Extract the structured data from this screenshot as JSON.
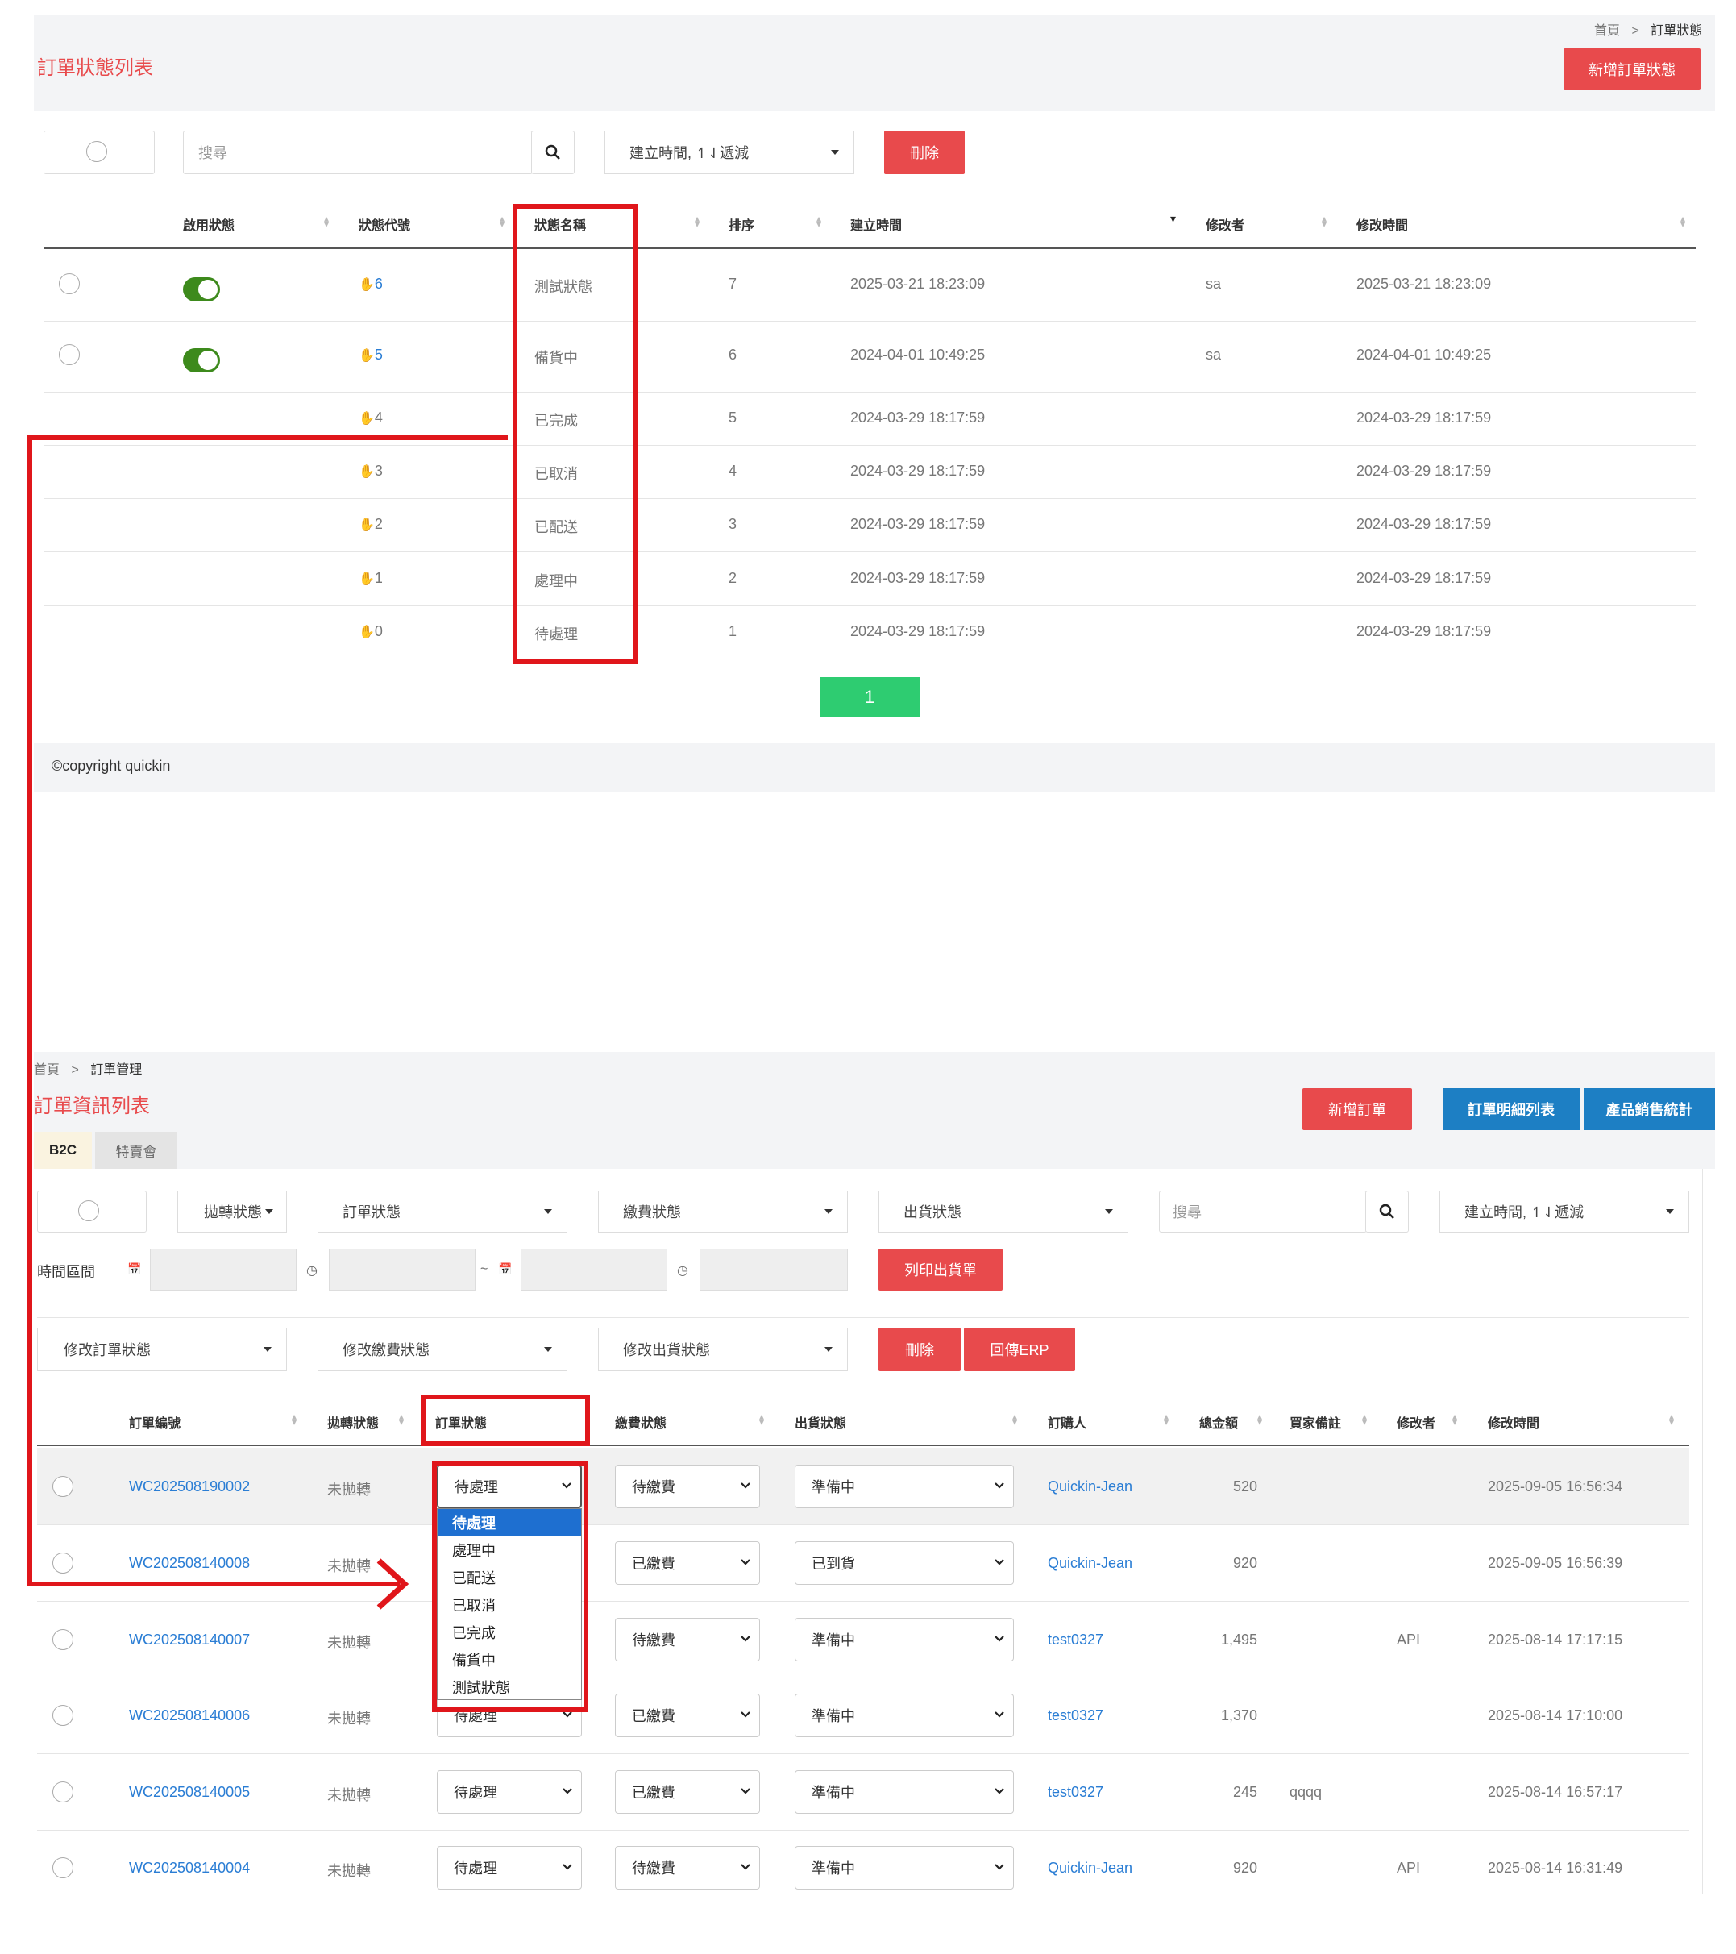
{
  "top": {
    "breadcrumb": {
      "home": "首頁",
      "sep": ">",
      "current": "訂單狀態"
    },
    "title": "訂單狀態列表",
    "add_button": "新增訂單狀態",
    "search_placeholder": "搜尋",
    "sort_dropdown": "建立時間, ↿⇃遞減",
    "delete_button": "刪除",
    "columns": [
      "啟用狀態",
      "狀態代號",
      "狀態名稱",
      "排序",
      "建立時間",
      "修改者",
      "修改時間"
    ],
    "rows": [
      {
        "enabled": true,
        "code": "6",
        "name": "測試狀態",
        "order": "7",
        "created": "2025-03-21 18:23:09",
        "modifier": "sa",
        "modified": "2025-03-21 18:23:09"
      },
      {
        "enabled": true,
        "code": "5",
        "name": "備貨中",
        "order": "6",
        "created": "2024-04-01 10:49:25",
        "modifier": "sa",
        "modified": "2024-04-01 10:49:25"
      },
      {
        "enabled": false,
        "code": "4",
        "name": "已完成",
        "order": "5",
        "created": "2024-03-29 18:17:59",
        "modifier": "",
        "modified": "2024-03-29 18:17:59"
      },
      {
        "enabled": false,
        "code": "3",
        "name": "已取消",
        "order": "4",
        "created": "2024-03-29 18:17:59",
        "modifier": "",
        "modified": "2024-03-29 18:17:59"
      },
      {
        "enabled": false,
        "code": "2",
        "name": "已配送",
        "order": "3",
        "created": "2024-03-29 18:17:59",
        "modifier": "",
        "modified": "2024-03-29 18:17:59"
      },
      {
        "enabled": false,
        "code": "1",
        "name": "處理中",
        "order": "2",
        "created": "2024-03-29 18:17:59",
        "modifier": "",
        "modified": "2024-03-29 18:17:59"
      },
      {
        "enabled": false,
        "code": "0",
        "name": "待處理",
        "order": "1",
        "created": "2024-03-29 18:17:59",
        "modifier": "",
        "modified": "2024-03-29 18:17:59"
      }
    ],
    "page": "1",
    "copyright": "©copyright quickin"
  },
  "bottom": {
    "breadcrumb": {
      "home": "首頁",
      "sep": ">",
      "current": "訂單管理"
    },
    "title": "訂單資訊列表",
    "add_order": "新增訂單",
    "detail_list": "訂單明細列表",
    "sales_stats": "產品銷售統計",
    "tabs": [
      "B2C",
      "特賣會"
    ],
    "filters": {
      "transfer": "拋轉狀態",
      "order_status": "訂單狀態",
      "payment_status": "繳費狀態",
      "shipping_status": "出貨狀態",
      "search_placeholder": "搜尋",
      "sort": "建立時間, ↿⇃遞減",
      "time_range": "時間區間",
      "tilde": "~",
      "print_button": "列印出貨單"
    },
    "bulk": {
      "order_status": "修改訂單狀態",
      "payment_status": "修改繳費狀態",
      "shipping_status": "修改出貨狀態",
      "delete": "刪除",
      "erp": "回傳ERP"
    },
    "columns": [
      "訂單編號",
      "拋轉狀態",
      "訂單狀態",
      "繳費狀態",
      "出貨狀態",
      "訂購人",
      "總金額",
      "買家備註",
      "修改者",
      "修改時間"
    ],
    "rows": [
      {
        "id": "WC202508190002",
        "transfer": "未拋轉",
        "order_status": "待處理",
        "payment": "待繳費",
        "shipping": "準備中",
        "buyer": "Quickin-Jean",
        "total": "520",
        "note": "",
        "modifier": "",
        "modified": "2025-09-05 16:56:34"
      },
      {
        "id": "WC202508140008",
        "transfer": "未拋轉",
        "order_status": "待處理",
        "payment": "已繳費",
        "shipping": "已到貨",
        "buyer": "Quickin-Jean",
        "total": "920",
        "note": "",
        "modifier": "",
        "modified": "2025-09-05 16:56:39"
      },
      {
        "id": "WC202508140007",
        "transfer": "未拋轉",
        "order_status": "待處理",
        "payment": "待繳費",
        "shipping": "準備中",
        "buyer": "test0327",
        "total": "1,495",
        "note": "",
        "modifier": "API",
        "modified": "2025-08-14 17:17:15"
      },
      {
        "id": "WC202508140006",
        "transfer": "未拋轉",
        "order_status": "待處理",
        "payment": "已繳費",
        "shipping": "準備中",
        "buyer": "test0327",
        "total": "1,370",
        "note": "",
        "modifier": "",
        "modified": "2025-08-14 17:10:00"
      },
      {
        "id": "WC202508140005",
        "transfer": "未拋轉",
        "order_status": "待處理",
        "payment": "已繳費",
        "shipping": "準備中",
        "buyer": "test0327",
        "total": "245",
        "note": "qqqq",
        "modifier": "",
        "modified": "2025-08-14 16:57:17"
      },
      {
        "id": "WC202508140004",
        "transfer": "未拋轉",
        "order_status": "待處理",
        "payment": "待繳費",
        "shipping": "準備中",
        "buyer": "Quickin-Jean",
        "total": "920",
        "note": "",
        "modifier": "API",
        "modified": "2025-08-14 16:31:49"
      }
    ],
    "dropdown_options": [
      "待處理",
      "處理中",
      "已配送",
      "已取消",
      "已完成",
      "備貨中",
      "測試狀態"
    ]
  },
  "colors": {
    "accent_red": "#e84a4c",
    "blue": "#1d7fc4",
    "green": "#2ecc71",
    "annotation": "#e0161b"
  }
}
